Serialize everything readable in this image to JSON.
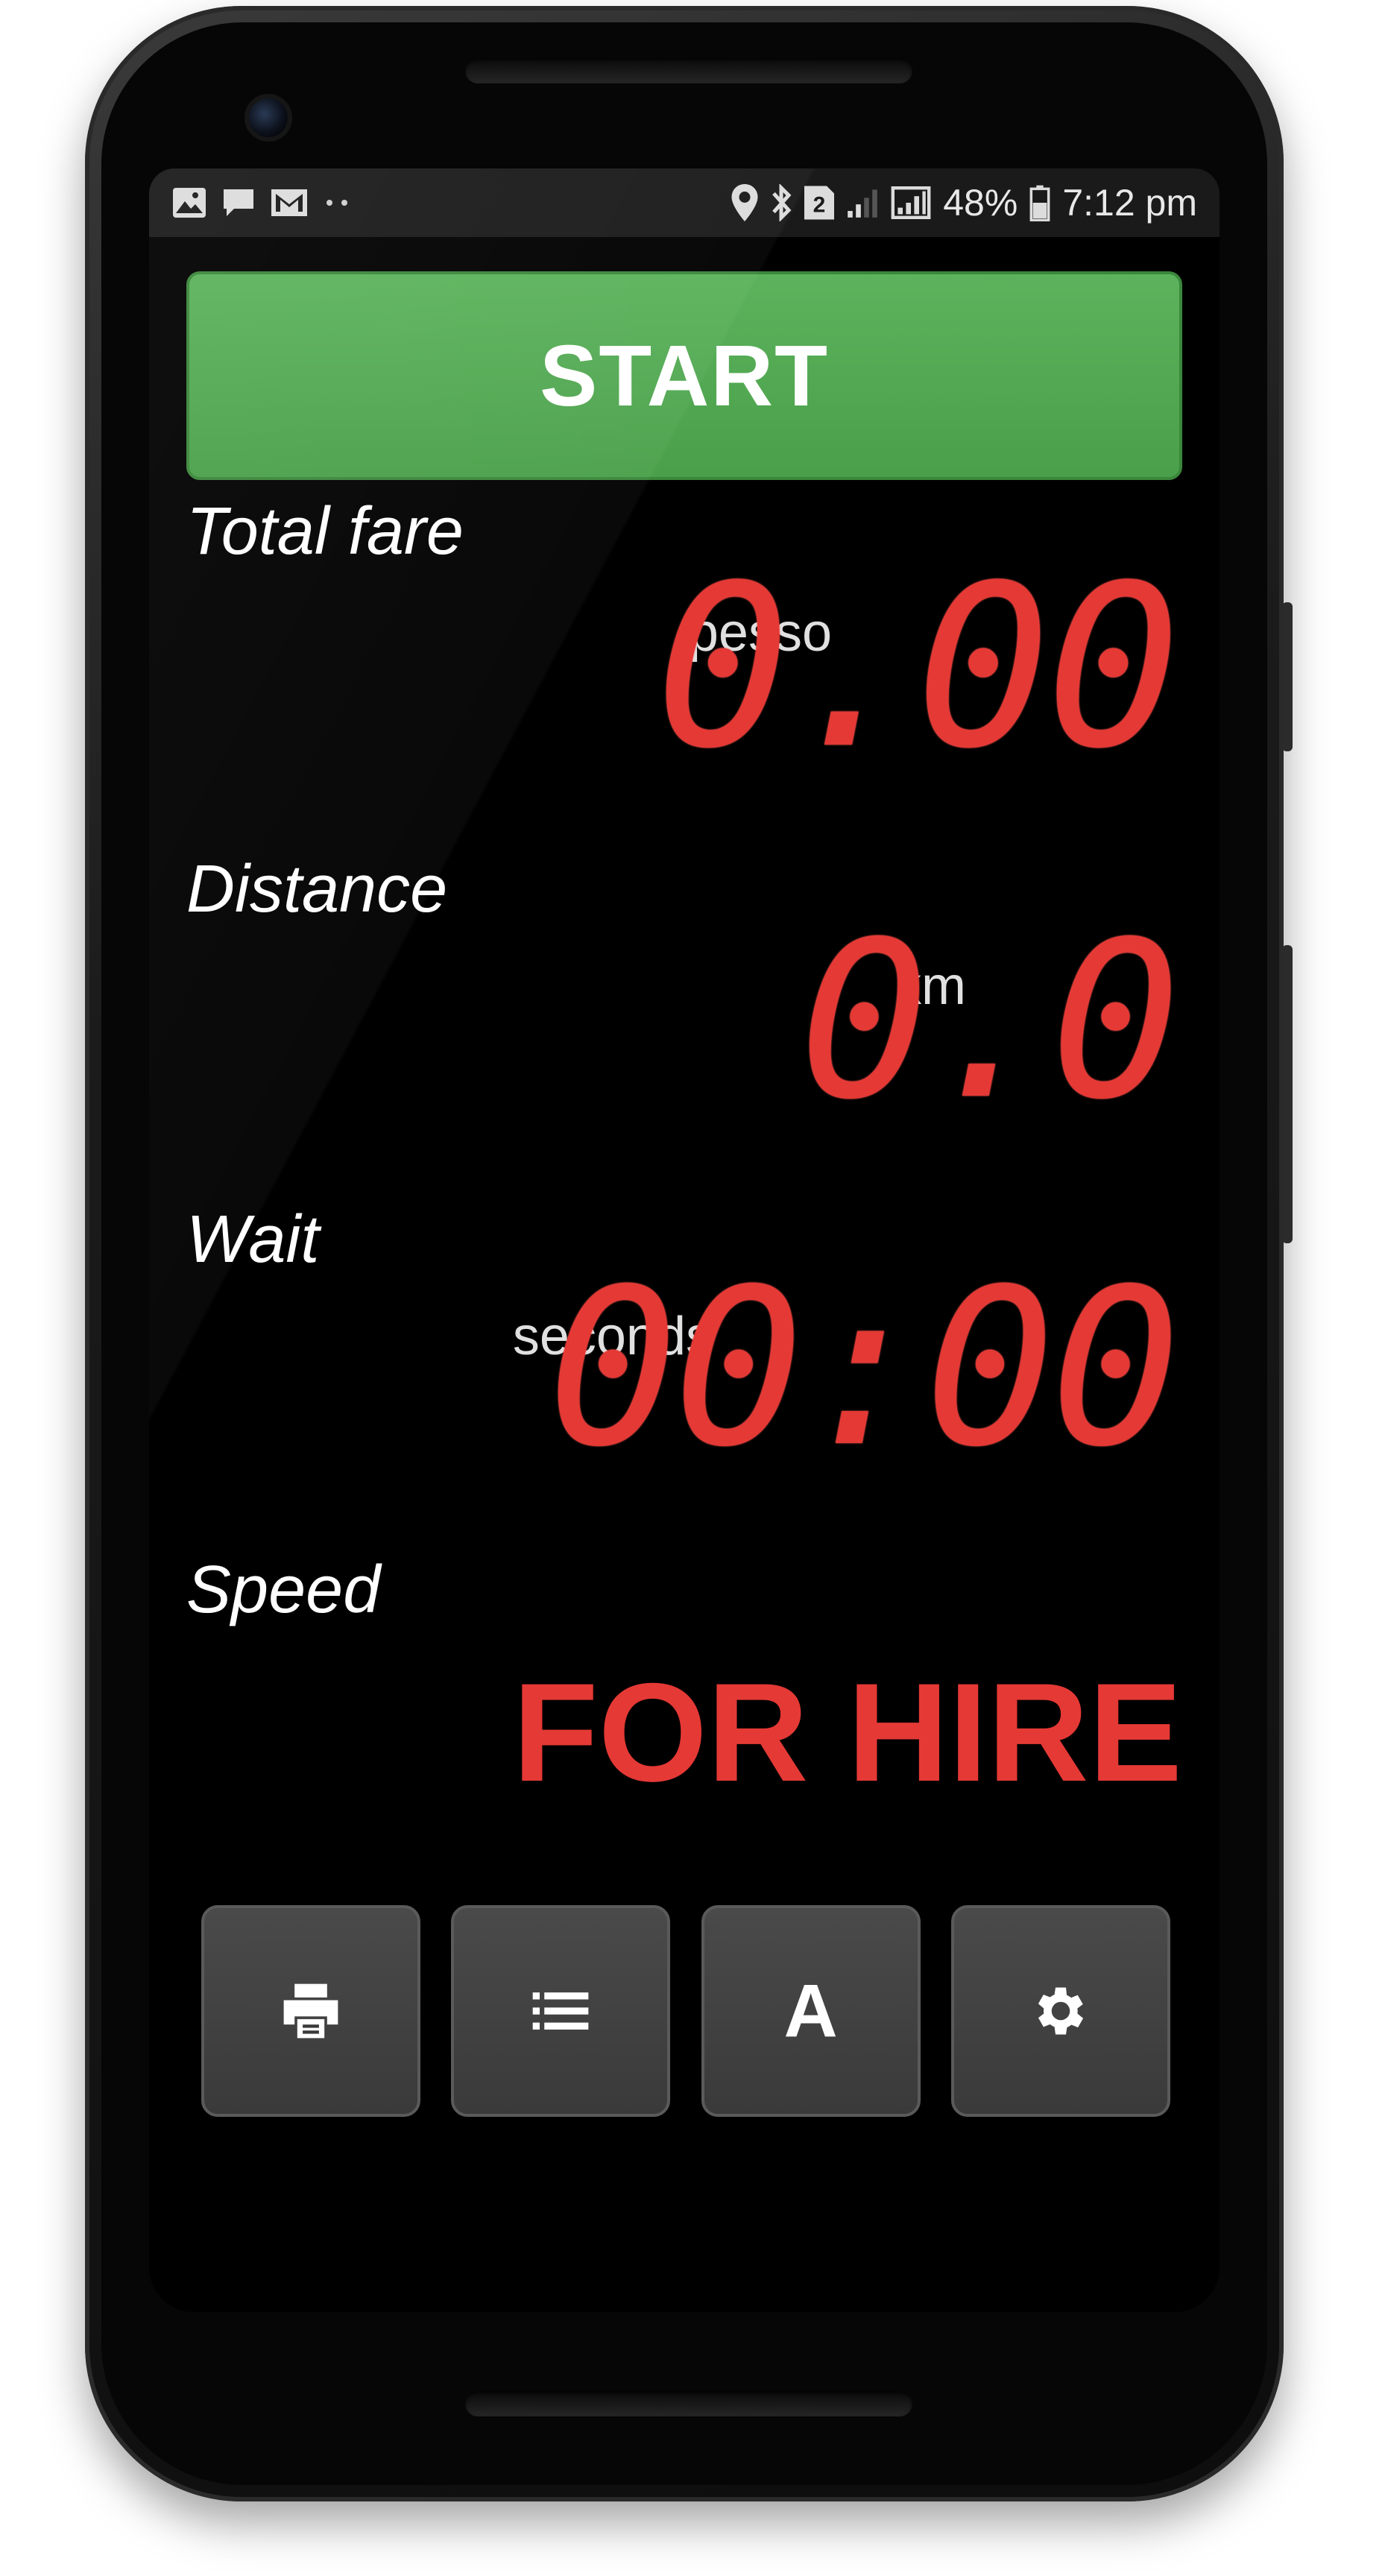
{
  "status_bar": {
    "left_icons": [
      "gallery-icon",
      "message-icon",
      "gmail-icon",
      "more-dots-icon"
    ],
    "right_icons": [
      "location-icon",
      "bluetooth-icon",
      "sim-2-icon",
      "signal-weak-icon",
      "signal-icon"
    ],
    "battery_percent": "48%",
    "time": "7:12 pm"
  },
  "start_button": {
    "label": "START"
  },
  "fare": {
    "label": "Total fare",
    "unit": "pesso",
    "value": "0.00"
  },
  "distance": {
    "label": "Distance",
    "unit": "km",
    "value": "0.0"
  },
  "wait": {
    "label": "Wait",
    "unit": "seconds",
    "value": "00:00"
  },
  "speed": {
    "label": "Speed"
  },
  "status": {
    "text": "FOR HIRE"
  },
  "toolbar": {
    "buttons": [
      {
        "icon": "print-icon"
      },
      {
        "icon": "list-icon"
      },
      {
        "icon": "font-icon",
        "label": "A"
      },
      {
        "icon": "settings-gear-icon"
      }
    ]
  },
  "colors": {
    "start_green": "#4caf50",
    "display_red": "#e53935",
    "background": "#000000",
    "button_gray": "#424242"
  }
}
